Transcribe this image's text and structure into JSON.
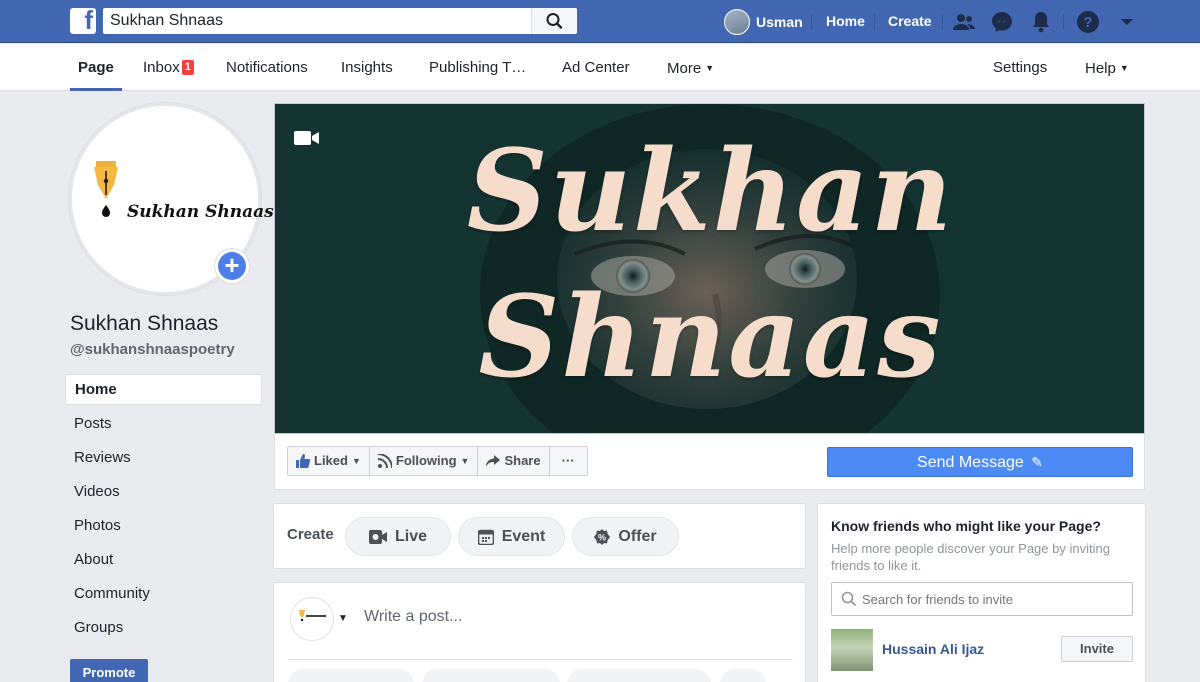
{
  "topbar": {
    "search_value": "Sukhan Shnaas",
    "user_name": "Usman",
    "home_label": "Home",
    "create_label": "Create",
    "logo_letter": "f"
  },
  "page_nav": {
    "items": [
      {
        "label": "Page",
        "active": true
      },
      {
        "label": "Inbox",
        "badge": "1"
      },
      {
        "label": "Notifications"
      },
      {
        "label": "Insights"
      },
      {
        "label": "Publishing T…"
      },
      {
        "label": "Ad Center"
      },
      {
        "label": "More"
      }
    ],
    "settings_label": "Settings",
    "help_label": "Help"
  },
  "profile": {
    "logo_text": "Sukhan Shnaas",
    "name": "Sukhan Shnaas",
    "handle": "@sukhanshnaaspoetry"
  },
  "left_nav": {
    "items": [
      "Home",
      "Posts",
      "Reviews",
      "Videos",
      "Photos",
      "About",
      "Community",
      "Groups"
    ],
    "promote_label": "Promote"
  },
  "cover": {
    "line1": "Sukhan",
    "line2": "Shnaas"
  },
  "actions": {
    "liked": "Liked",
    "following": "Following",
    "share": "Share",
    "more": "···",
    "send_message": "Send Message"
  },
  "create": {
    "label": "Create",
    "live": "Live",
    "event": "Event",
    "offer": "Offer"
  },
  "post_box": {
    "placeholder": "Write a post..."
  },
  "invite": {
    "title": "Know friends who might like your Page?",
    "subtitle": "Help more people discover your Page by inviting friends to like it.",
    "search_placeholder": "Search for friends to invite",
    "friend_name": "Hussain Ali Ijaz",
    "invite_label": "Invite"
  },
  "colors": {
    "brand_blue": "#4267b2",
    "send_blue": "#4c8bf5",
    "badge_red": "#fa3e3e",
    "cover_text": "#f6dccb"
  }
}
